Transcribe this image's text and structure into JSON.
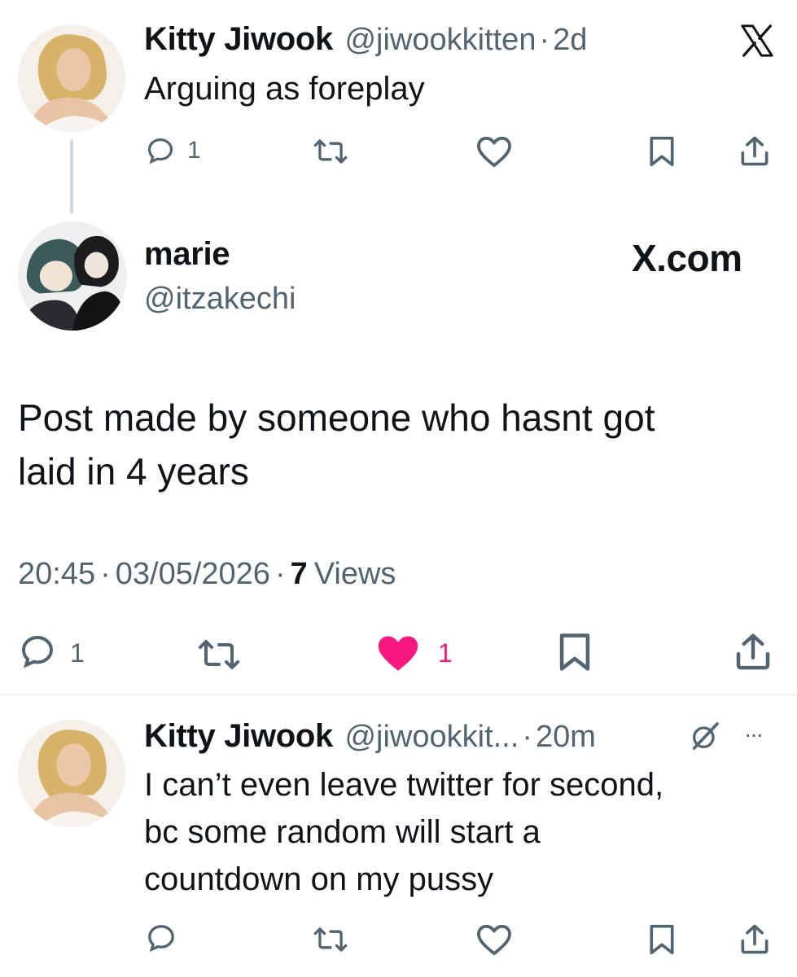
{
  "post1": {
    "display_name": "Kitty Jiwook",
    "handle": "@jiwookkitten",
    "separator": "·",
    "age": "2d",
    "text": "Arguing as foreplay",
    "reply_count": "1",
    "logo_icon": "x-logo-icon"
  },
  "post2": {
    "display_name": "marie",
    "handle": "@itzakechi",
    "site_label": "X.com",
    "text_line1": "Post made by someone who hasnt got",
    "text_line2": "laid in 4 years",
    "time": "20:45",
    "date": "03/05/2026",
    "views_count": "7",
    "views_label": "Views",
    "separator": "·",
    "reply_count": "1",
    "like_count": "1",
    "like_color": "#f91880"
  },
  "post3": {
    "display_name": "Kitty Jiwook",
    "handle": "@jiwookkit...",
    "separator": "·",
    "age": "20m",
    "text_line1": "I can’t even leave twitter for second,",
    "text_line2": "bc some random will start a",
    "text_line3": "countdown on my pussy",
    "more_label": "···"
  },
  "colors": {
    "text": "#0f1419",
    "muted": "#536471",
    "like": "#f91880",
    "thread_line": "#cfd9de"
  }
}
